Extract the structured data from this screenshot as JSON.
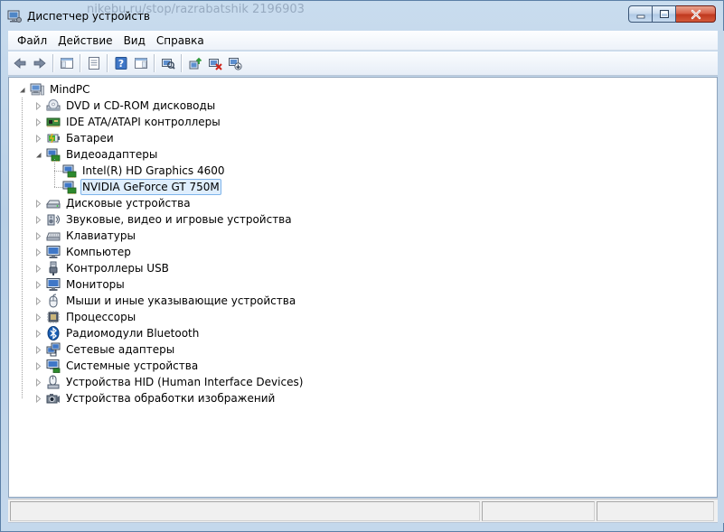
{
  "window": {
    "title": "Диспетчер устройств",
    "ghost_text": "nikebu.ru/stop/razrabatshik 2196903"
  },
  "menu": [
    {
      "label": "Файл",
      "key": "file"
    },
    {
      "label": "Действие",
      "key": "action"
    },
    {
      "label": "Вид",
      "key": "view"
    },
    {
      "label": "Справка",
      "key": "help"
    }
  ],
  "toolbar": [
    {
      "icon": "back-arrow-icon"
    },
    {
      "icon": "forward-arrow-icon"
    },
    {
      "sep": true
    },
    {
      "icon": "console-tree-icon"
    },
    {
      "sep": true
    },
    {
      "icon": "properties-icon"
    },
    {
      "sep": true
    },
    {
      "icon": "help-icon"
    },
    {
      "icon": "action-pane-icon"
    },
    {
      "sep": true
    },
    {
      "icon": "scan-hardware-icon"
    },
    {
      "sep": true
    },
    {
      "icon": "update-driver-icon"
    },
    {
      "icon": "uninstall-icon"
    },
    {
      "icon": "disable-icon"
    }
  ],
  "tree": {
    "root": {
      "label": "MindPC",
      "icon": "computer-icon",
      "expanded": true
    },
    "items": [
      {
        "label": "DVD и CD-ROM дисководы",
        "icon": "dvd-drive-icon",
        "expanded": false
      },
      {
        "label": "IDE ATA/ATAPI контроллеры",
        "icon": "ide-controller-icon",
        "expanded": false
      },
      {
        "label": "Батареи",
        "icon": "battery-icon",
        "expanded": false
      },
      {
        "label": "Видеоадаптеры",
        "icon": "display-adapter-icon",
        "expanded": true,
        "children": [
          {
            "label": "Intel(R) HD Graphics 4600",
            "icon": "display-adapter-icon",
            "selected": false
          },
          {
            "label": "NVIDIA GeForce GT 750M",
            "icon": "display-adapter-icon",
            "selected": true
          }
        ]
      },
      {
        "label": "Дисковые устройства",
        "icon": "disk-drive-icon",
        "expanded": false
      },
      {
        "label": "Звуковые, видео и игровые устройства",
        "icon": "speaker-icon",
        "expanded": false
      },
      {
        "label": "Клавиатуры",
        "icon": "keyboard-icon",
        "expanded": false
      },
      {
        "label": "Компьютер",
        "icon": "monitor-icon",
        "expanded": false
      },
      {
        "label": "Контроллеры USB",
        "icon": "usb-icon",
        "expanded": false
      },
      {
        "label": "Мониторы",
        "icon": "monitor-icon",
        "expanded": false
      },
      {
        "label": "Мыши и иные указывающие устройства",
        "icon": "mouse-icon",
        "expanded": false
      },
      {
        "label": "Процессоры",
        "icon": "processor-icon",
        "expanded": false
      },
      {
        "label": "Радиомодули Bluetooth",
        "icon": "bluetooth-icon",
        "expanded": false
      },
      {
        "label": "Сетевые адаптеры",
        "icon": "network-adapter-icon",
        "expanded": false
      },
      {
        "label": "Системные устройства",
        "icon": "system-device-icon",
        "expanded": false
      },
      {
        "label": "Устройства HID (Human Interface Devices)",
        "icon": "hid-icon",
        "expanded": false
      },
      {
        "label": "Устройства обработки изображений",
        "icon": "camera-icon",
        "expanded": false
      }
    ]
  },
  "colors": {
    "selection_bg": "#dfeefd",
    "selection_border": "#7eb4ea",
    "close_button": "#c0391f"
  }
}
